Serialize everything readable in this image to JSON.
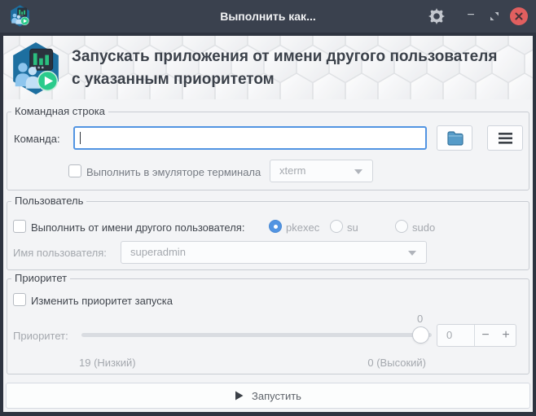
{
  "titlebar": {
    "title": "Выполнить как...",
    "minimize_glyph": "−"
  },
  "header": {
    "line1": "Запускать приложения от имени другого пользователя",
    "line2": "с указанным приоритетом"
  },
  "sections": {
    "command": {
      "legend": "Командная строка",
      "command_label": "Команда:",
      "command_value": "",
      "terminal_label": "Выполнить в эмуляторе терминала",
      "terminal_checked": false,
      "terminal_emulator": "xterm"
    },
    "user": {
      "legend": "Пользователь",
      "runas_label": "Выполнить от имени другого пользователя:",
      "runas_checked": false,
      "methods": [
        {
          "label": "pkexec",
          "selected": true
        },
        {
          "label": "su",
          "selected": false
        },
        {
          "label": "sudo",
          "selected": false
        }
      ],
      "username_label": "Имя пользователя:",
      "username_value": "superadmin"
    },
    "priority": {
      "legend": "Приоритет",
      "change_label": "Изменить приоритет запуска",
      "change_checked": false,
      "priority_label": "Приоритет:",
      "slider_value_label": "0",
      "slider_value": 0,
      "slider_min": 19,
      "slider_max": 0,
      "spin_value": "0",
      "spin_minus": "−",
      "spin_plus": "+",
      "mark_low": "19 (Низкий)",
      "mark_high": "0 (Высокий)"
    }
  },
  "run_button": {
    "label": "Запустить"
  },
  "colors": {
    "accent_blue": "#5294e2",
    "close_red": "#e15f5f",
    "titlebar_bg": "#3a414e",
    "body_bg": "#f3f4f6",
    "play_green": "#2bcb8c",
    "folder_blue": "#569bc8"
  }
}
